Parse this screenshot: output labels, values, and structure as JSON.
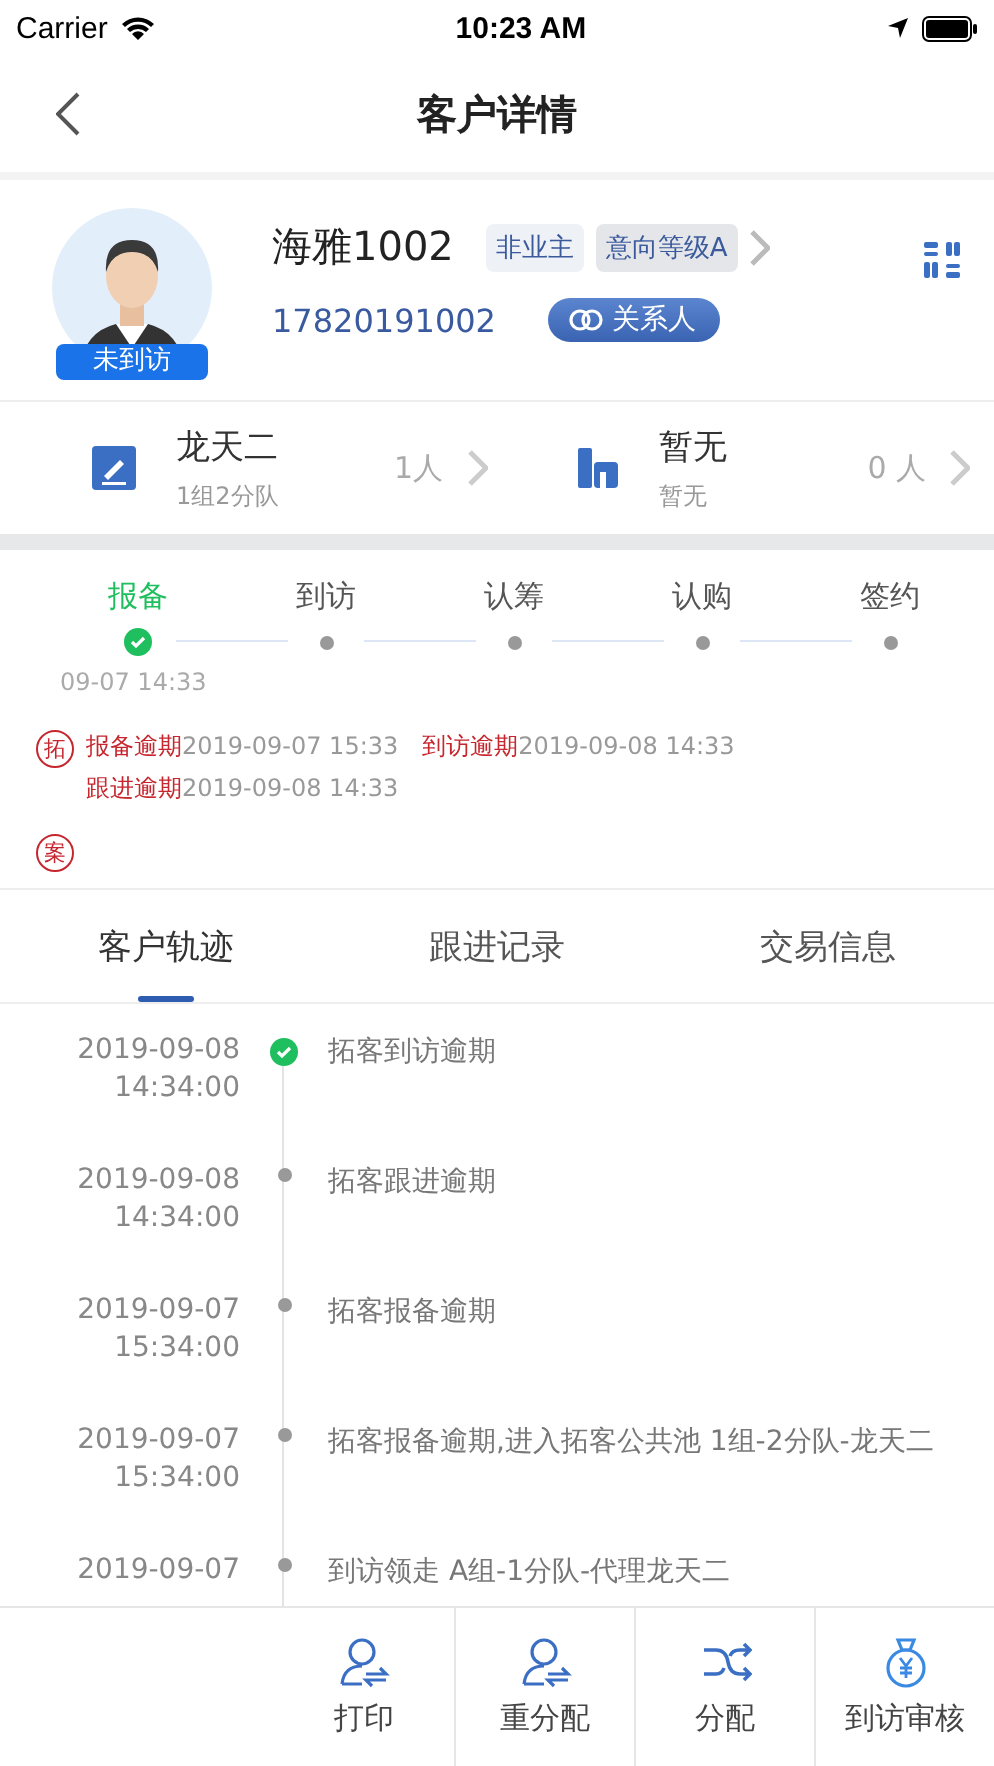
{
  "status_bar": {
    "carrier": "Carrier",
    "time": "10:23 AM"
  },
  "nav": {
    "title": "客户详情"
  },
  "customer": {
    "name": "海雅1002",
    "visit_badge": "未到访",
    "tags": [
      "非业主",
      "意向等级A"
    ],
    "phone": "17820191002",
    "relation_button": "关系人"
  },
  "agents": [
    {
      "kind": "pen",
      "name": "龙天二",
      "sub": "1组2分队",
      "count": "1人"
    },
    {
      "kind": "building",
      "name": "暂无",
      "sub": "暂无",
      "count": "0 人"
    }
  ],
  "stages": [
    {
      "label": "报备",
      "selected": true,
      "time": "09-07 14:33"
    },
    {
      "label": "到访",
      "selected": false
    },
    {
      "label": "认筹",
      "selected": false
    },
    {
      "label": "认购",
      "selected": false
    },
    {
      "label": "签约",
      "selected": false
    }
  ],
  "overdue": [
    {
      "badge": "拓",
      "items": [
        {
          "label": "报备逾期",
          "time": "2019-09-07 15:33"
        },
        {
          "label": "到访逾期",
          "time": "2019-09-08 14:33"
        },
        {
          "label": "跟进逾期",
          "time": "2019-09-08 14:33"
        }
      ]
    },
    {
      "badge": "案"
    }
  ],
  "tabs": [
    {
      "label": "客户轨迹",
      "selected": true
    },
    {
      "label": "跟进记录",
      "selected": false
    },
    {
      "label": "交易信息",
      "selected": false
    }
  ],
  "timeline": [
    {
      "date": "2019-09-08",
      "time": "14:34:00",
      "text": "拓客到访逾期",
      "done": true
    },
    {
      "date": "2019-09-08",
      "time": "14:34:00",
      "text": "拓客跟进逾期",
      "done": false
    },
    {
      "date": "2019-09-07",
      "time": "15:34:00",
      "text": "拓客报备逾期",
      "done": false
    },
    {
      "date": "2019-09-07",
      "time": "15:34:00",
      "text": "拓客报备逾期,进入拓客公共池 1组-2分队-龙天二",
      "done": false
    },
    {
      "date": "2019-09-07",
      "text": "到访领走 A组-1分队-代理龙天二",
      "done": false
    }
  ],
  "actions": [
    {
      "kind": "person",
      "label": "打印"
    },
    {
      "kind": "person",
      "label": "重分配"
    },
    {
      "kind": "shuffle",
      "label": "分配"
    },
    {
      "kind": "money",
      "label": "到访审核"
    }
  ]
}
